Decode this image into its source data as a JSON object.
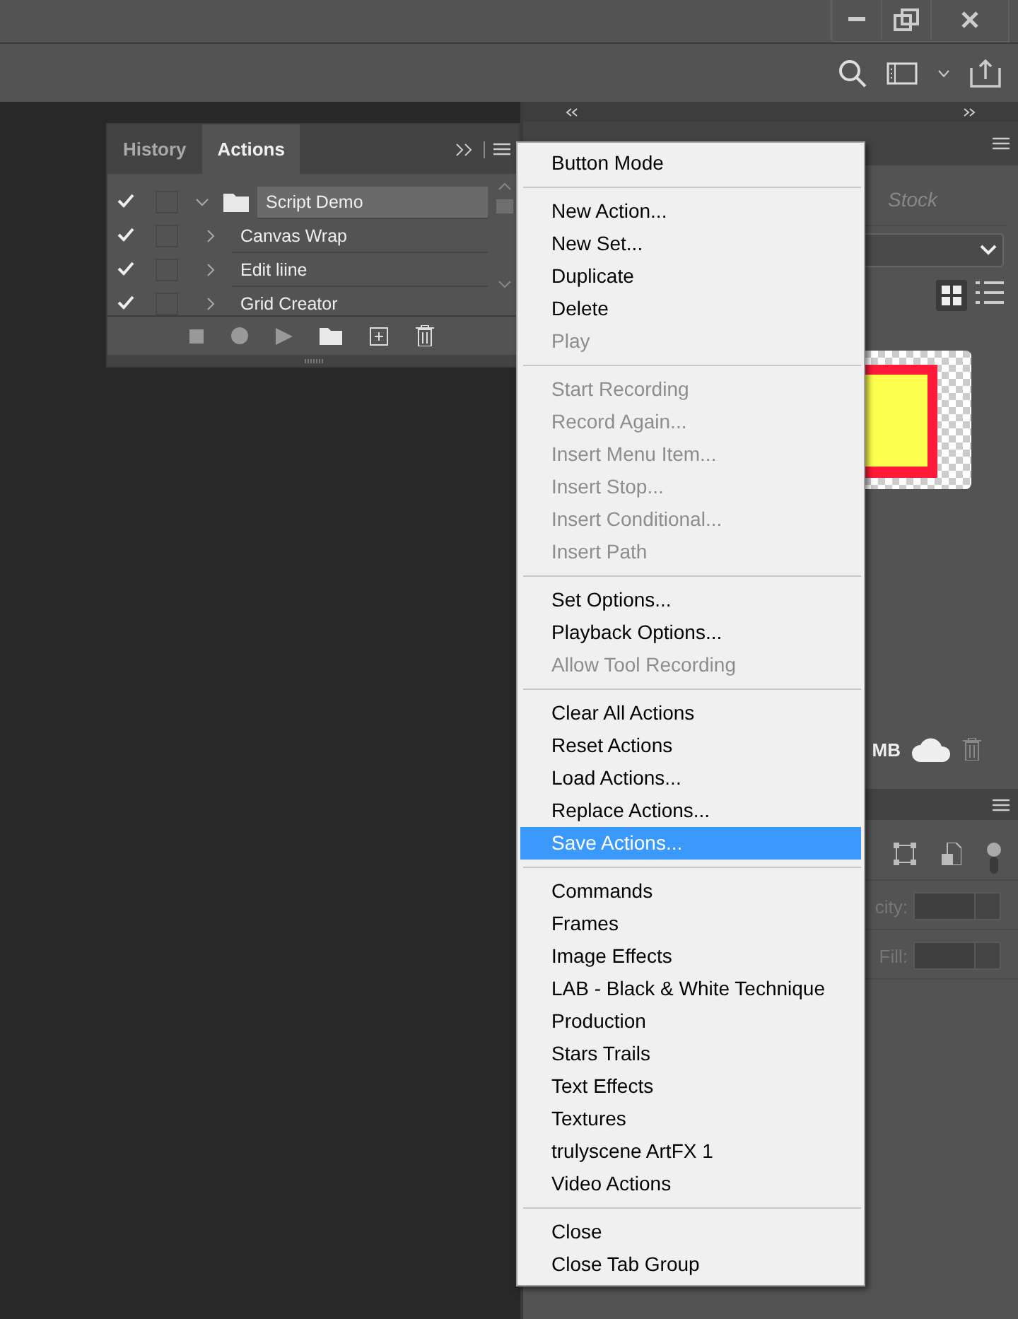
{
  "actions_panel": {
    "tabs": [
      {
        "label": "History",
        "selected": false
      },
      {
        "label": "Actions",
        "selected": true
      }
    ],
    "rows": [
      {
        "name": "Script Demo",
        "kind": "set",
        "checked": true,
        "expanded": true,
        "selected": true
      },
      {
        "name": "Canvas Wrap",
        "kind": "action",
        "checked": true,
        "expanded": false,
        "selected": false
      },
      {
        "name": "Edit liine",
        "kind": "action",
        "checked": true,
        "expanded": false,
        "selected": false
      },
      {
        "name": "Grid Creator",
        "kind": "action",
        "checked": true,
        "expanded": false,
        "selected": false
      }
    ]
  },
  "libraries_panel": {
    "search": {
      "placeholder": "Stock"
    },
    "storage": "MB"
  },
  "layers_panel": {
    "opacity_label": "city:",
    "fill_label": "Fill:"
  },
  "context_menu": {
    "sections": [
      [
        {
          "label": "Button Mode",
          "disabled": false,
          "selected": false
        }
      ],
      [
        {
          "label": "New Action...",
          "disabled": false,
          "selected": false
        },
        {
          "label": "New Set...",
          "disabled": false,
          "selected": false
        },
        {
          "label": "Duplicate",
          "disabled": false,
          "selected": false
        },
        {
          "label": "Delete",
          "disabled": false,
          "selected": false
        },
        {
          "label": "Play",
          "disabled": true,
          "selected": false
        }
      ],
      [
        {
          "label": "Start Recording",
          "disabled": true,
          "selected": false
        },
        {
          "label": "Record Again...",
          "disabled": true,
          "selected": false
        },
        {
          "label": "Insert Menu Item...",
          "disabled": true,
          "selected": false
        },
        {
          "label": "Insert Stop...",
          "disabled": true,
          "selected": false
        },
        {
          "label": "Insert Conditional...",
          "disabled": true,
          "selected": false
        },
        {
          "label": "Insert Path",
          "disabled": true,
          "selected": false
        }
      ],
      [
        {
          "label": "Set Options...",
          "disabled": false,
          "selected": false
        },
        {
          "label": "Playback Options...",
          "disabled": false,
          "selected": false
        },
        {
          "label": "Allow Tool Recording",
          "disabled": true,
          "selected": false
        }
      ],
      [
        {
          "label": "Clear All Actions",
          "disabled": false,
          "selected": false
        },
        {
          "label": "Reset Actions",
          "disabled": false,
          "selected": false
        },
        {
          "label": "Load Actions...",
          "disabled": false,
          "selected": false
        },
        {
          "label": "Replace Actions...",
          "disabled": false,
          "selected": false
        },
        {
          "label": "Save Actions...",
          "disabled": false,
          "selected": true
        }
      ],
      [
        {
          "label": "Commands",
          "disabled": false,
          "selected": false
        },
        {
          "label": "Frames",
          "disabled": false,
          "selected": false
        },
        {
          "label": "Image Effects",
          "disabled": false,
          "selected": false
        },
        {
          "label": "LAB - Black & White Technique",
          "disabled": false,
          "selected": false
        },
        {
          "label": "Production",
          "disabled": false,
          "selected": false
        },
        {
          "label": "Stars Trails",
          "disabled": false,
          "selected": false
        },
        {
          "label": "Text Effects",
          "disabled": false,
          "selected": false
        },
        {
          "label": "Textures",
          "disabled": false,
          "selected": false
        },
        {
          "label": "trulyscene ArtFX 1",
          "disabled": false,
          "selected": false
        },
        {
          "label": "Video Actions",
          "disabled": false,
          "selected": false
        }
      ],
      [
        {
          "label": "Close",
          "disabled": false,
          "selected": false
        },
        {
          "label": "Close Tab Group",
          "disabled": false,
          "selected": false
        }
      ]
    ]
  }
}
